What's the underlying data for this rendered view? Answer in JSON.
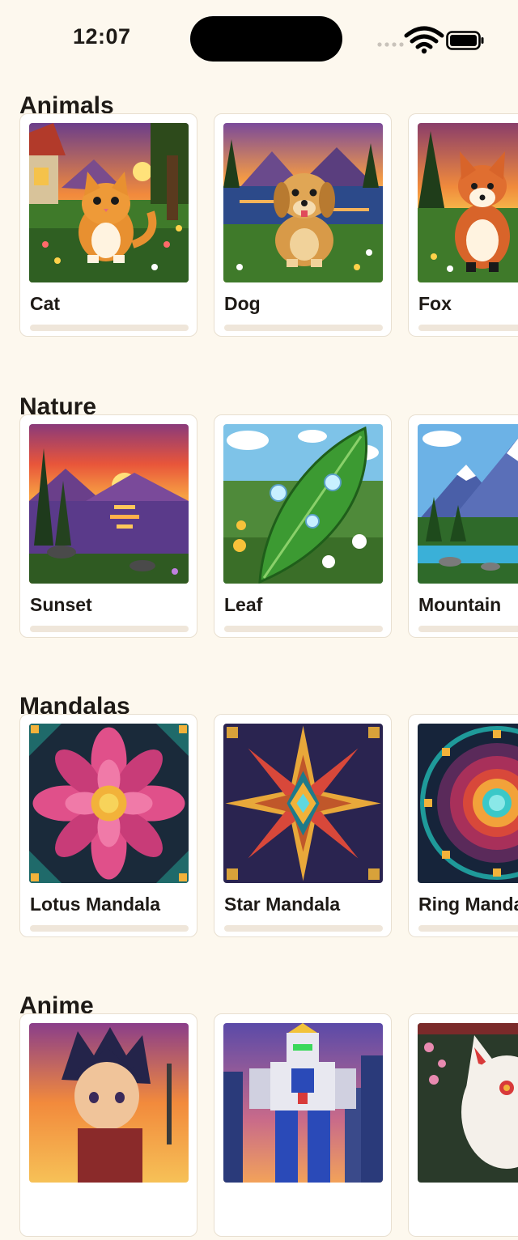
{
  "status_bar": {
    "time": "12:07"
  },
  "sections": [
    {
      "title": "Animals",
      "cards": [
        {
          "title": "Cat",
          "progress": 0,
          "image_icon": "cat-pixel-art"
        },
        {
          "title": "Dog",
          "progress": 0,
          "image_icon": "dog-pixel-art"
        },
        {
          "title": "Fox",
          "progress": 0,
          "image_icon": "fox-pixel-art"
        }
      ]
    },
    {
      "title": "Nature",
      "cards": [
        {
          "title": "Sunset",
          "progress": 0,
          "image_icon": "sunset-pixel-art"
        },
        {
          "title": "Leaf",
          "progress": 0,
          "image_icon": "leaf-pixel-art"
        },
        {
          "title": "Mountain",
          "progress": 0,
          "image_icon": "mountain-pixel-art"
        }
      ]
    },
    {
      "title": "Mandalas",
      "cards": [
        {
          "title": "Lotus Mandala",
          "progress": 0,
          "image_icon": "lotus-mandala-pixel-art"
        },
        {
          "title": "Star Mandala",
          "progress": 0,
          "image_icon": "star-mandala-pixel-art"
        },
        {
          "title": "Ring Mandala",
          "progress": 0,
          "image_icon": "ring-mandala-pixel-art"
        }
      ]
    },
    {
      "title": "Anime",
      "cards": [
        {
          "title": "",
          "progress": 0,
          "image_icon": "anime-hero-pixel-art"
        },
        {
          "title": "",
          "progress": 0,
          "image_icon": "robot-mech-pixel-art"
        },
        {
          "title": "",
          "progress": 0,
          "image_icon": "kitsune-mask-pixel-art"
        }
      ]
    }
  ],
  "colors": {
    "background": "#fdf8ee",
    "card": "#ffffff",
    "card_border": "#e8dfd0",
    "progress_track": "#efe6da",
    "text": "#1e1a16"
  }
}
